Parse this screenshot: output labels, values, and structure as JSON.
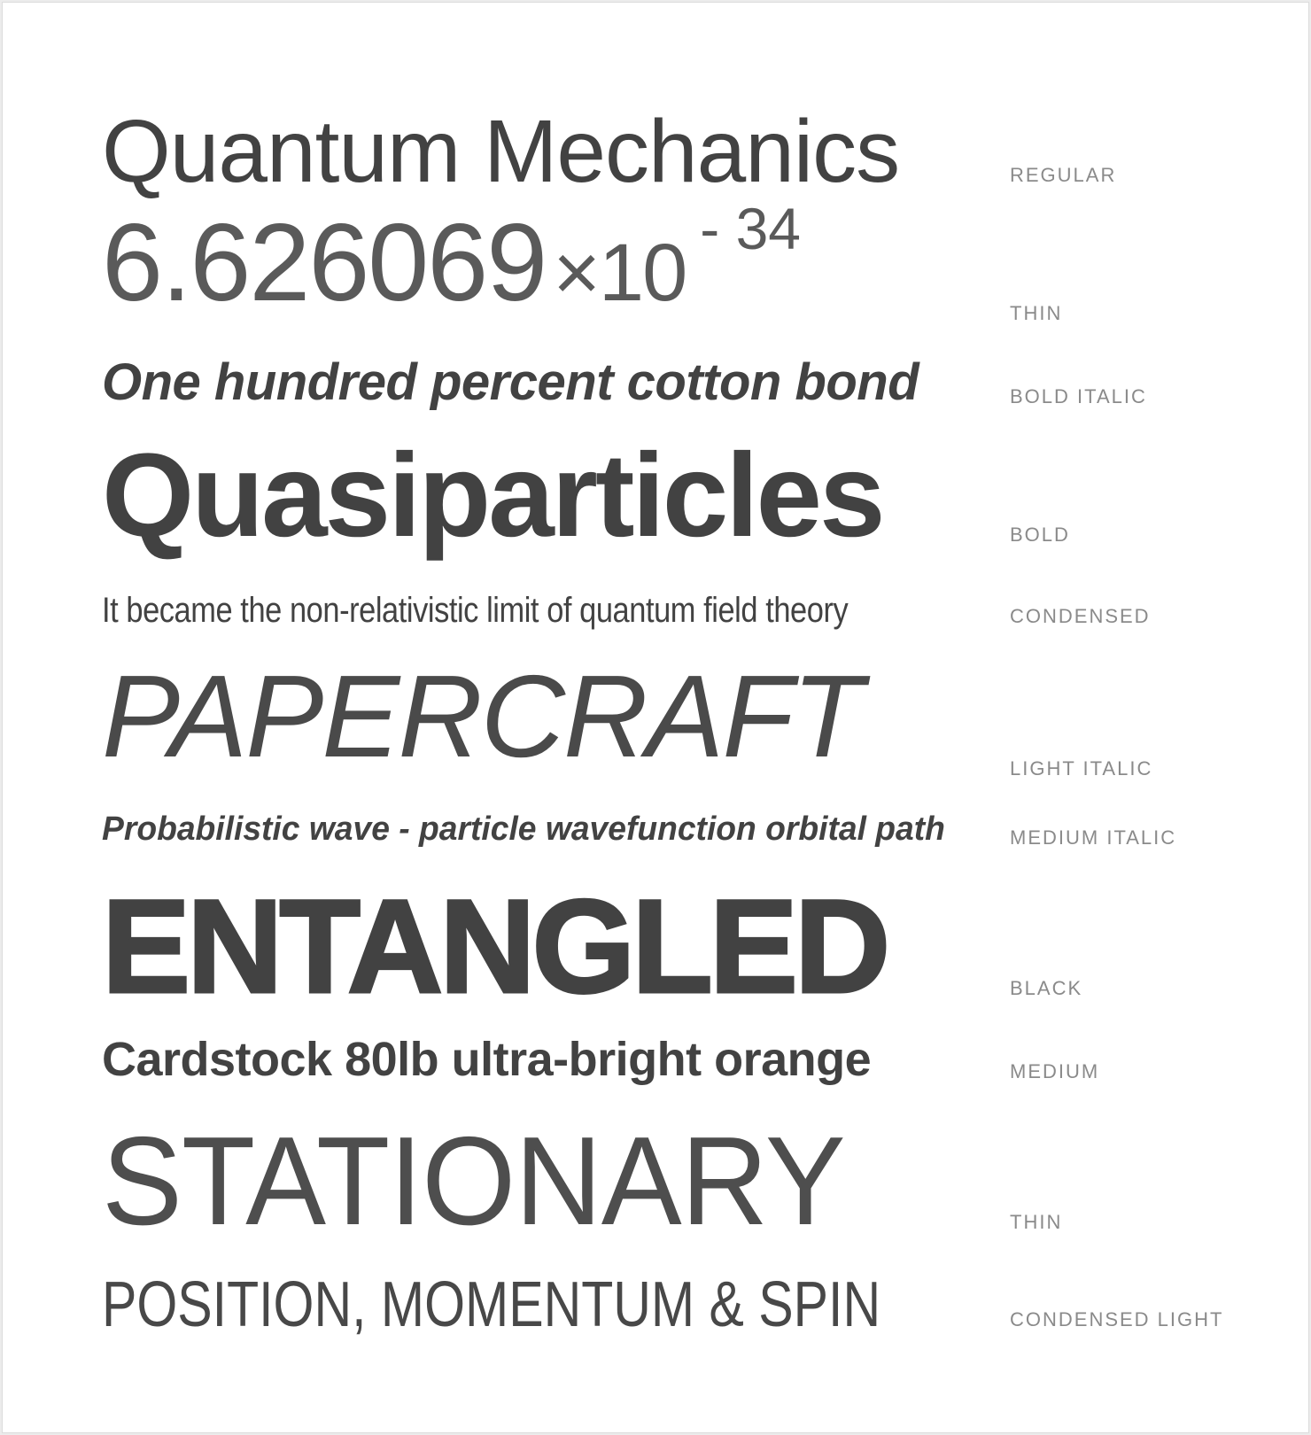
{
  "specimens": [
    {
      "text": "Quantum Mechanics",
      "style_label": "REGULAR"
    },
    {
      "number": {
        "mantissa": "6.626069",
        "times": "×10",
        "exponent": "- 34"
      },
      "style_label": "THIN"
    },
    {
      "text": "One hundred percent cotton bond",
      "style_label": "BOLD ITALIC"
    },
    {
      "text": "Quasiparticles",
      "style_label": "BOLD"
    },
    {
      "text": "It became the non-relativistic limit of quantum field theory",
      "style_label": "CONDENSED"
    },
    {
      "text": "PAPERCRAFT",
      "style_label": "LIGHT ITALIC"
    },
    {
      "text": "Probabilistic wave - particle wavefunction orbital path",
      "style_label": "MEDIUM ITALIC"
    },
    {
      "text": "ENTANGLED",
      "style_label": "BLACK"
    },
    {
      "text": "Cardstock 80lb ultra-bright orange",
      "style_label": "MEDIUM"
    },
    {
      "text": "STATIONARY",
      "style_label": "THIN"
    },
    {
      "text": "POSITION, MOMENTUM & SPIN",
      "style_label": "CONDENSED LIGHT"
    }
  ],
  "colors": {
    "sample_text": "#424242",
    "label_text": "#8a8a8a",
    "background": "#ffffff"
  }
}
